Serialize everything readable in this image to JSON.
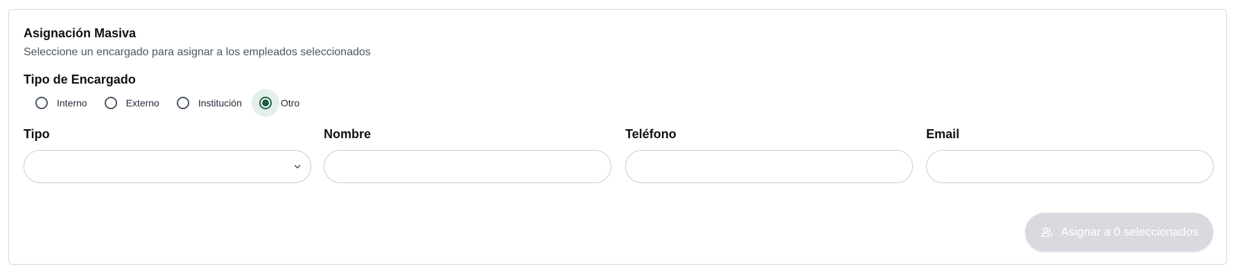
{
  "header": {
    "title": "Asignación Masiva",
    "subtitle": "Seleccione un encargado para asignar a los empleados seleccionados"
  },
  "tipo_encargado": {
    "label": "Tipo de Encargado",
    "options": [
      {
        "label": "Interno",
        "selected": false
      },
      {
        "label": "Externo",
        "selected": false
      },
      {
        "label": "Institución",
        "selected": false
      },
      {
        "label": "Otro",
        "selected": true
      }
    ]
  },
  "fields": {
    "tipo": {
      "label": "Tipo",
      "value": "",
      "placeholder": ""
    },
    "nombre": {
      "label": "Nombre",
      "value": "",
      "placeholder": ""
    },
    "telefono": {
      "label": "Teléfono",
      "value": "",
      "placeholder": ""
    },
    "email": {
      "label": "Email",
      "value": "",
      "placeholder": ""
    }
  },
  "action": {
    "label": "Asignar a 0 seleccionados",
    "icon": "users-icon",
    "disabled": true
  },
  "colors": {
    "accent": "#1f5c44",
    "accent_bg": "#e3efe9",
    "disabled_button": "#d8dadf"
  }
}
